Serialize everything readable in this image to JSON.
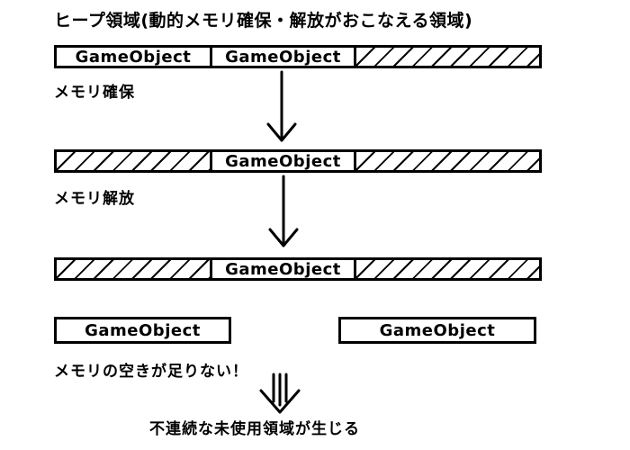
{
  "title": "ヒープ領域(動的メモリ確保・解放がおこなえる領域)",
  "segment_label": "GameObject",
  "captions": {
    "allocate": "メモリ確保",
    "free": "メモリ解放",
    "no_space": "メモリの空きが足りない！",
    "result": "不連続な未使用領域が生じる"
  }
}
